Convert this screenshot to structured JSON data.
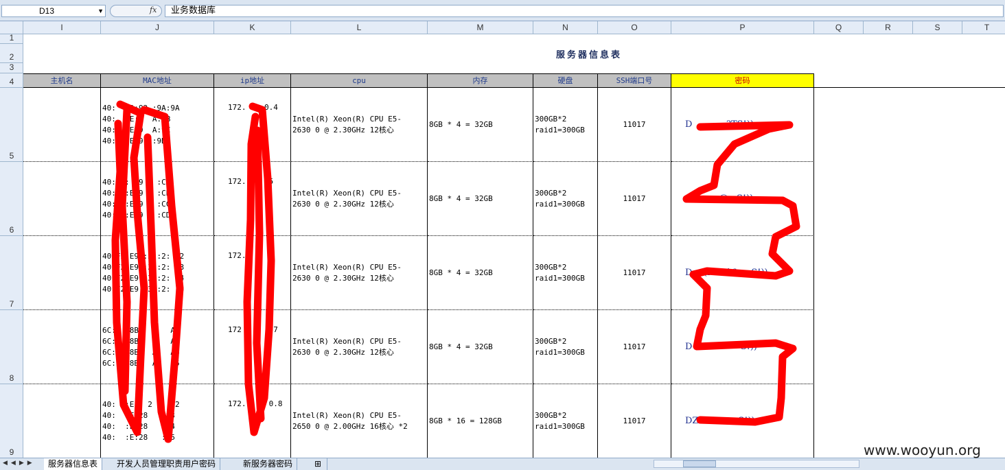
{
  "formula_bar": {
    "name_box": "D13",
    "fx": "fx",
    "content": "业务数据库"
  },
  "columns": [
    "I",
    "J",
    "K",
    "L",
    "M",
    "N",
    "O",
    "P",
    "Q",
    "R",
    "S",
    "T"
  ],
  "rows": [
    "1",
    "2",
    "3",
    "4",
    "5",
    "6",
    "7",
    "8",
    "9"
  ],
  "sheet_title": "服务器信息表",
  "headers": {
    "hostname": "主机名",
    "mac": "MAC地址",
    "ip": "ip地址",
    "cpu": "cpu",
    "memory": "内存",
    "disk": "硬盘",
    "ssh_port": "SSH端口号",
    "password": "密码"
  },
  "records": [
    {
      "mac": "40:  :9:93 :9A:9A\n40:  :E:9  A:9B\n40:  :E:9  A:9C\n40:  :E:9  :9D",
      "ip": "172.    0.4",
      "cpu": "Intel(R) Xeon(R) CPU E5-\n2630 0 @ 2.30GHz 12核心",
      "memory": "8GB * 4 = 32GB",
      "disk": "300GB*2\nraid1=300GB",
      "ssh_port": "11017",
      "password": "D            ?TS!))"
    },
    {
      "mac": "40:F2:  9   :CA\n40:F2:E:9   :CB\n40:F2:E:9   :CC\n40:F2:E:9   :CD",
      "ip": "172.     5",
      "cpu": "Intel(R) Xeon(R) CPU E5-\n2630 0 @ 2.30GHz 12核心",
      "memory": "8GB * 4 = 32GB",
      "disk": "300GB*2\nraid1=300GB",
      "ssh_port": "11017",
      "password": "            @   S!))"
    },
    {
      "mac": "40:F2:E9 :3 :2:  2\n40:F2:E9 :3 :2:  3\n40:F2:E9 :3 :2:  4\n40:F2:E9 :3 :2:  5",
      "ip": "172.     6",
      "cpu": "Intel(R) Xeon(R) CPU E5-\n2630 0 @ 2.30GHz 12核心",
      "memory": "8GB * 4 = 32GB",
      "disk": "300GB*2\nraid1=300GB",
      "ssh_port": "11017",
      "password": "D    (root16     S!))"
    },
    {
      "mac": "6C:  :8B:  A   A2\n6C:  :8B:  A   A3\n6C:  :8B:  A   A4\n6C:  :8B:  A   A5",
      "ip": "172       7",
      "cpu": "Intel(R) Xeon(R) CPU E5-\n2630 0 @ 2.30GHz 12核心",
      "memory": "8GB * 4 = 32GB",
      "disk": "300GB*2\nraid1=300GB",
      "ssh_port": "11017",
      "password": "D   007        S!))"
    },
    {
      "mac": "40:  :E:  2   :82\n40:  :E:28   :83\n40:  :E:28   :84\n40:  :E:28   :85",
      "ip": "172.     0.8",
      "cpu": "Intel(R) Xeon(R) CPU E5-\n2650 0 @ 2.00GHz 16核心 *2",
      "memory": "8GB * 16 = 128GB",
      "disk": "300GB*2\nraid1=300GB",
      "ssh_port": "11017",
      "password": "DZ              S!))"
    }
  ],
  "sheet_tabs": [
    "服务器信息表",
    "开发人员管理职责用户密码",
    "新服务器密码"
  ],
  "watermark": "www.wooyun.org"
}
